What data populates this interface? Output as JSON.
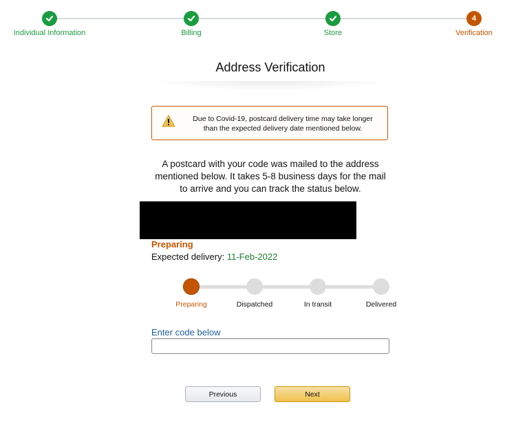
{
  "stepper": {
    "steps": [
      {
        "label": "Individual Information",
        "state": "done",
        "icon": "check-icon"
      },
      {
        "label": "Billing",
        "state": "done",
        "icon": "check-icon"
      },
      {
        "label": "Store",
        "state": "done",
        "icon": "check-icon"
      },
      {
        "label": "Verification",
        "state": "active",
        "number": "4"
      }
    ]
  },
  "page_title": "Address Verification",
  "alert": {
    "icon": "warning-icon",
    "text": "Due to Covid-19, postcard delivery time may take longer than the expected delivery date mentioned below."
  },
  "info_text": "A postcard with your code was mailed to the address mentioned below. It takes 5-8 business days for the mail to arrive and you can track the status below.",
  "status": {
    "label": "Preparing",
    "expected_prefix": "Expected delivery:",
    "expected_date": "11-Feb-2022"
  },
  "tracking": {
    "stages": [
      "Preparing",
      "Dispatched",
      "In transit",
      "Delivered"
    ],
    "current_index": 0
  },
  "code": {
    "label": "Enter code below",
    "value": "",
    "placeholder": ""
  },
  "buttons": {
    "previous": "Previous",
    "next": "Next"
  },
  "colors": {
    "done": "#1a9c3f",
    "active": "#c45500",
    "pending": "#dddddd",
    "link_label": "#1f5c99",
    "primary_button": "#f0c14b"
  }
}
